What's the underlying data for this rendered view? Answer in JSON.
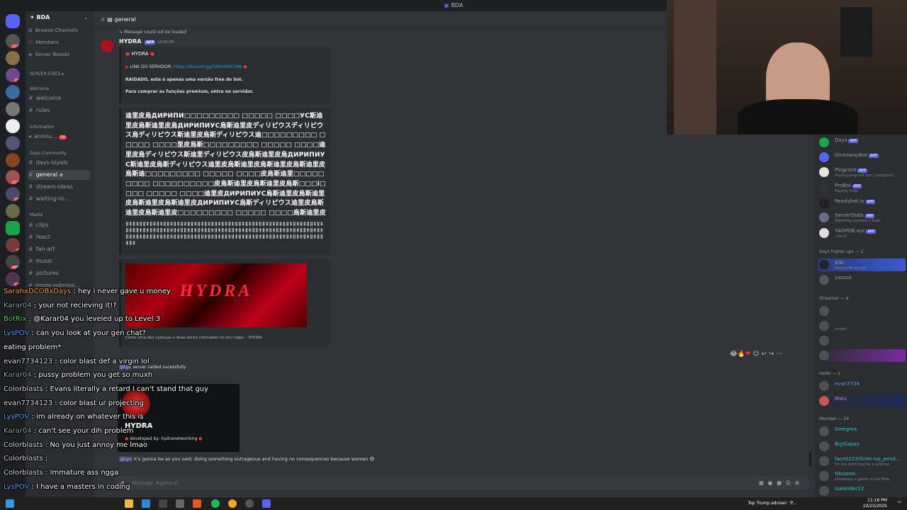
{
  "window": {
    "title": "BDA"
  },
  "server": {
    "name": "BDA"
  },
  "channel_header": {
    "name": "general"
  },
  "channels": {
    "top_items": [
      "Browse Channels",
      "Members",
      "Server Boosts"
    ],
    "server_stats": "SERVER STATS",
    "welcome_category": "Welcome",
    "welcome": "welcome",
    "rules": "rules",
    "info_category": "Information",
    "announce": "annou...",
    "announce_badge": "10",
    "days_category": "Days Community",
    "days_loyals": "days-loyals",
    "general": "general",
    "stream_ideas": "stream-ideas",
    "waiting": "waiting-ro...",
    "media_category": "Media",
    "clips": "clips",
    "react": "react",
    "fan_art": "fan-art",
    "music": "music",
    "pictures": "pictures",
    "emote": "emote-submissi..."
  },
  "server_badges": [
    "174",
    "33",
    "172",
    "18",
    "6",
    "403",
    "11"
  ],
  "messages": {
    "not_loaded": "Message could not be loaded",
    "author": "HYDRA",
    "app_tag": "APP",
    "time": "10:53 PM",
    "embed_title": "HYDRA",
    "link_label": "LINK DO SERVIDOR:",
    "link_url": "https://discord.gg/5WXnRHCY8b",
    "line_raidado": "RAIDADO, esta é apenas uma versão free do bot.",
    "line_premium": "Para comprar as funções premium, entre no servidor.",
    "cjk_block": "迪里皮烏ДИРИПИ□□□□□□□□□ □□□□□ □□□□УС斯迪里皮烏斯迪里皮烏ДИРИПИУС烏斯迪里皮ディリピウスディリピウス烏ディリピウス斯迪里皮烏斯ディリピウス迪□□□□□□□□□ □□□□□ □□□□里皮烏斯□□□□□□□□□ □□□□□ □□□□迪里皮烏ディリピウス斯迪里ディリピウス皮烏斯迪里皮烏ДИРИПИУС斯迪里皮烏斯ディリピウス迪里皮烏斯迪里皮烏斯迪里皮烏斯迪里皮烏斯迪□□□□□□□□□ □□□□□ □□□□皮烏斯迪里□□□□□□□□□ □□□□□□□□□□皮烏斯迪里皮烏斯迪里皮烏斯□□□i□□□□ □□□□□ □□□□迪里皮ДИРИПИУС烏斯迪里皮烏斯迪里皮烏斯迪里皮烏斯迪里皮ДИРИПИУС烏斯ディリピウス迪里皮烏斯迪里皮烏斯迪里皮□□□□□□□□□ □□□□□ □□□□烏斯迪里皮烏斯ディリピウス迪里皮烏斯",
    "noise_block": "ǁǂǁǂǁǁǂǁǂǁǂǁǁǂǁǂǁǂǁǁǂǁǂǁǂǁǁǂǁǂǁǂǁǁǂǁǂǁǂǁǁǂǁǂǁǂǁǁǂǁǂǁǂǁǁǂǁǂǁǂǁǁǂǁǂǁǂǁǁǂǁǂǁǂǁǁǂǁǂǁǂǁǁǂǁǂǁǂǁǁǂǁǂǁǂǁǁǂǁǂǁǂǁǁǂǁǂǁǂǁǁǂǁǂǁǂǁǁǂǁǂǁǂǁǁǂǁǂǁǂǁǁǂǁǂǁǂǁǁǂǁǂǁǂǁǁǂǁǂǁǂǁǁǂǁǂǁǂǁǁǂǁǂǁǂǁǁǂǁǂǁǂǁǁǂǁǂ",
    "banner_text": "HYDRA",
    "banner_caption": "Corte uma das cabeças e duas serão colocadas no seu lugar. - HYDRA",
    "raided_mention": "@Lys",
    "raided_text": "server raided sucessfully",
    "popup_title": "HYDRA",
    "popup_footer": "developed by: hydranetworking",
    "last_mention": "@Lys",
    "last_text": "it's gonna be as  you said, doing something outrageous and having no consequences because women"
  },
  "composer": {
    "placeholder": "Message #general"
  },
  "members": {
    "bots": [
      {
        "name": "Days",
        "tag": "APP",
        "status": ""
      },
      {
        "name": "GiveawayBot",
        "tag": "APP",
        "status": ""
      },
      {
        "name": "Pingcord",
        "tag": "APP",
        "status": "Playing pingcord.xyz | !pingcord |"
      },
      {
        "name": "ProBot",
        "tag": "APP",
        "status": "Playing /help"
      },
      {
        "name": "Readybot.io",
        "tag": "APP",
        "status": ""
      },
      {
        "name": "ServerStats",
        "tag": "APP",
        "status": "Watching counters | /help"
      },
      {
        "name": "YAGPDB.xyz",
        "tag": "APP",
        "status": "I Am It"
      }
    ],
    "higher_ups_header": "Days higher ups — 2",
    "higher_ups": [
      {
        "name": "Elbi",
        "status": "Playing Minecraft"
      },
      {
        "name": "yazzak",
        "status": ""
      }
    ],
    "streamer_header": "Streamer — 4",
    "streamers": [
      {
        "name": "",
        "status": ""
      },
      {
        "name": "",
        "status": "poopin"
      },
      {
        "name": "",
        "status": ""
      },
      {
        "name": "",
        "status": ""
      }
    ],
    "mods_header": "mods — 2",
    "mods": [
      {
        "name": "evan7734",
        "status": ""
      },
      {
        "name": "Mars",
        "status": ""
      }
    ],
    "member_header": "Member — 24",
    "member_list": [
      {
        "name": "Smegma",
        "status": ""
      },
      {
        "name": "BigSlappy",
        "status": ""
      },
      {
        "name": "face0223/Grim-ius_pend...",
        "status": "On the word frog for a surprise"
      },
      {
        "name": "Ghxstee",
        "status": "streaming + gamin in the Ethe..."
      },
      {
        "name": "isalander12",
        "status": ""
      }
    ]
  },
  "stream_chat": [
    {
      "user": "SarahxDCOBxDays",
      "msg": "hey i never gave u money",
      "color": "#ff9a3c"
    },
    {
      "user": "Karar04",
      "msg": "your not recieving it!?",
      "color": "#9aa0a6"
    },
    {
      "user": "BotRix",
      "msg": "@Karar04 you leveled up to Level 3",
      "color": "#54d26a"
    },
    {
      "user": "LysPOV",
      "msg": "can you look at your gen chat?",
      "color": "#4aa3ff"
    },
    {
      "user": "",
      "msg": "eating problem*",
      "color": "#ff3b3b"
    },
    {
      "user": "evan7734123",
      "msg": "color blast def a virgin lol",
      "color": "#d9d9d9"
    },
    {
      "user": "Karar04",
      "msg": "pussy problem you get so muxh",
      "color": "#9aa0a6"
    },
    {
      "user": "Colorblasts",
      "msg": "Evans literally a retard I can't stand that guy",
      "color": "#d9d9d9"
    },
    {
      "user": "evan7734123",
      "msg": "color blast ur projecting",
      "color": "#d9d9d9"
    },
    {
      "user": "LysPOV",
      "msg": "im already on whatever this is",
      "color": "#4aa3ff"
    },
    {
      "user": "Karar04",
      "msg": "can't see your dih problem",
      "color": "#9aa0a6"
    },
    {
      "user": "Colorblasts",
      "msg": "No you just annoy me lmao",
      "color": "#d9d9d9"
    },
    {
      "user": "Colorblasts",
      "msg": "",
      "color": "#d9d9d9"
    },
    {
      "user": "Colorblasts",
      "msg": "Immature ass ngga",
      "color": "#d9d9d9"
    },
    {
      "user": "LysPOV",
      "msg": "I have a masters in coding",
      "color": "#4aa3ff"
    },
    {
      "user": "LysPOV",
      "msg": "",
      "color": "#4aa3ff"
    }
  ],
  "taskbar": {
    "news": "Top Trump adviser: 'P...",
    "time": "11:16 PM",
    "date": "10/23/2025"
  },
  "colors": {
    "accent": "#5865f2",
    "danger": "#f23f43",
    "hydra_red": "#c0001a"
  }
}
